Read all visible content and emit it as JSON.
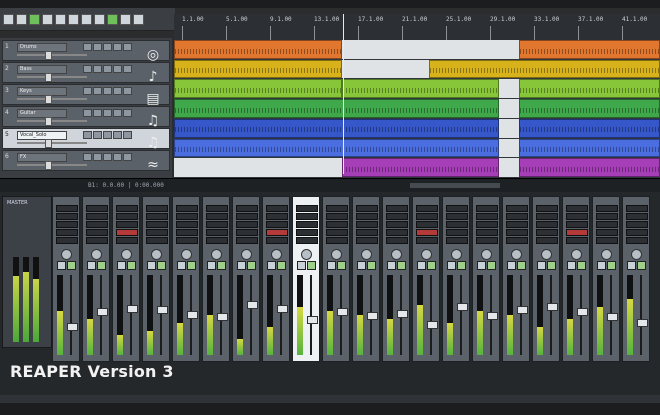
{
  "caption": "REAPER Version 3",
  "transport": {
    "time_display": "B1: 0.0.00 | 0:00.000"
  },
  "ruler": {
    "ticks": [
      "1.1.00",
      "5.1.00",
      "9.1.00",
      "13.1.00",
      "17.1.00",
      "21.1.00",
      "25.1.00",
      "29.1.00",
      "33.1.00",
      "37.1.00",
      "41.1.00"
    ]
  },
  "tracks": [
    {
      "num": "1",
      "name": "Drums",
      "icon": "drum-icon",
      "selected": false
    },
    {
      "num": "2",
      "name": "Bass",
      "icon": "mic-icon",
      "selected": false
    },
    {
      "num": "3",
      "name": "Keys",
      "icon": "keys-icon",
      "selected": false
    },
    {
      "num": "4",
      "name": "Guitar",
      "icon": "guitar-icon",
      "selected": false
    },
    {
      "num": "5",
      "name": "Vocal_Solo",
      "icon": "guitar-icon",
      "selected": true
    },
    {
      "num": "6",
      "name": "FX",
      "icon": "fx-icon",
      "selected": false
    }
  ],
  "lanes": [
    {
      "color": "#e1762f",
      "items": [
        [
          0,
          168
        ],
        [
          345,
          486
        ]
      ]
    },
    {
      "color": "#d8b21b",
      "items": [
        [
          0,
          168
        ],
        [
          255,
          486
        ]
      ]
    },
    {
      "color": "#86c638",
      "items": [
        [
          0,
          168
        ],
        [
          168,
          325
        ],
        [
          345,
          486
        ]
      ]
    },
    {
      "color": "#3fa84a",
      "items": [
        [
          0,
          325
        ],
        [
          345,
          486
        ]
      ]
    },
    {
      "color": "#3557c9",
      "items": [
        [
          0,
          325
        ],
        [
          345,
          486
        ]
      ]
    },
    {
      "color": "#4a6ee0",
      "items": [
        [
          0,
          325
        ],
        [
          345,
          486
        ]
      ]
    },
    {
      "color": "#a63fb7",
      "items": [
        [
          168,
          325
        ],
        [
          345,
          486
        ]
      ]
    }
  ],
  "master": {
    "label": "MASTER",
    "levels": [
      0.78,
      0.82,
      0.74
    ]
  },
  "mixer_strips": [
    {
      "level": 0.55,
      "fader": 0.35,
      "light": false
    },
    {
      "level": 0.45,
      "fader": 0.55,
      "light": false
    },
    {
      "level": 0.25,
      "fader": 0.6,
      "light": false
    },
    {
      "level": 0.3,
      "fader": 0.58,
      "light": false
    },
    {
      "level": 0.4,
      "fader": 0.52,
      "light": false
    },
    {
      "level": 0.5,
      "fader": 0.48,
      "light": false
    },
    {
      "level": 0.2,
      "fader": 0.65,
      "light": false
    },
    {
      "level": 0.35,
      "fader": 0.6,
      "light": false
    },
    {
      "level": 0.6,
      "fader": 0.45,
      "light": true
    },
    {
      "level": 0.55,
      "fader": 0.55,
      "light": false
    },
    {
      "level": 0.5,
      "fader": 0.5,
      "light": false
    },
    {
      "level": 0.45,
      "fader": 0.53,
      "light": false
    },
    {
      "level": 0.62,
      "fader": 0.38,
      "light": false
    },
    {
      "level": 0.4,
      "fader": 0.62,
      "light": false
    },
    {
      "level": 0.55,
      "fader": 0.5,
      "light": false
    },
    {
      "level": 0.5,
      "fader": 0.58,
      "light": false
    },
    {
      "level": 0.35,
      "fader": 0.62,
      "light": false
    },
    {
      "level": 0.45,
      "fader": 0.55,
      "light": false
    },
    {
      "level": 0.6,
      "fader": 0.48,
      "light": false
    },
    {
      "level": 0.7,
      "fader": 0.4,
      "light": false
    }
  ]
}
